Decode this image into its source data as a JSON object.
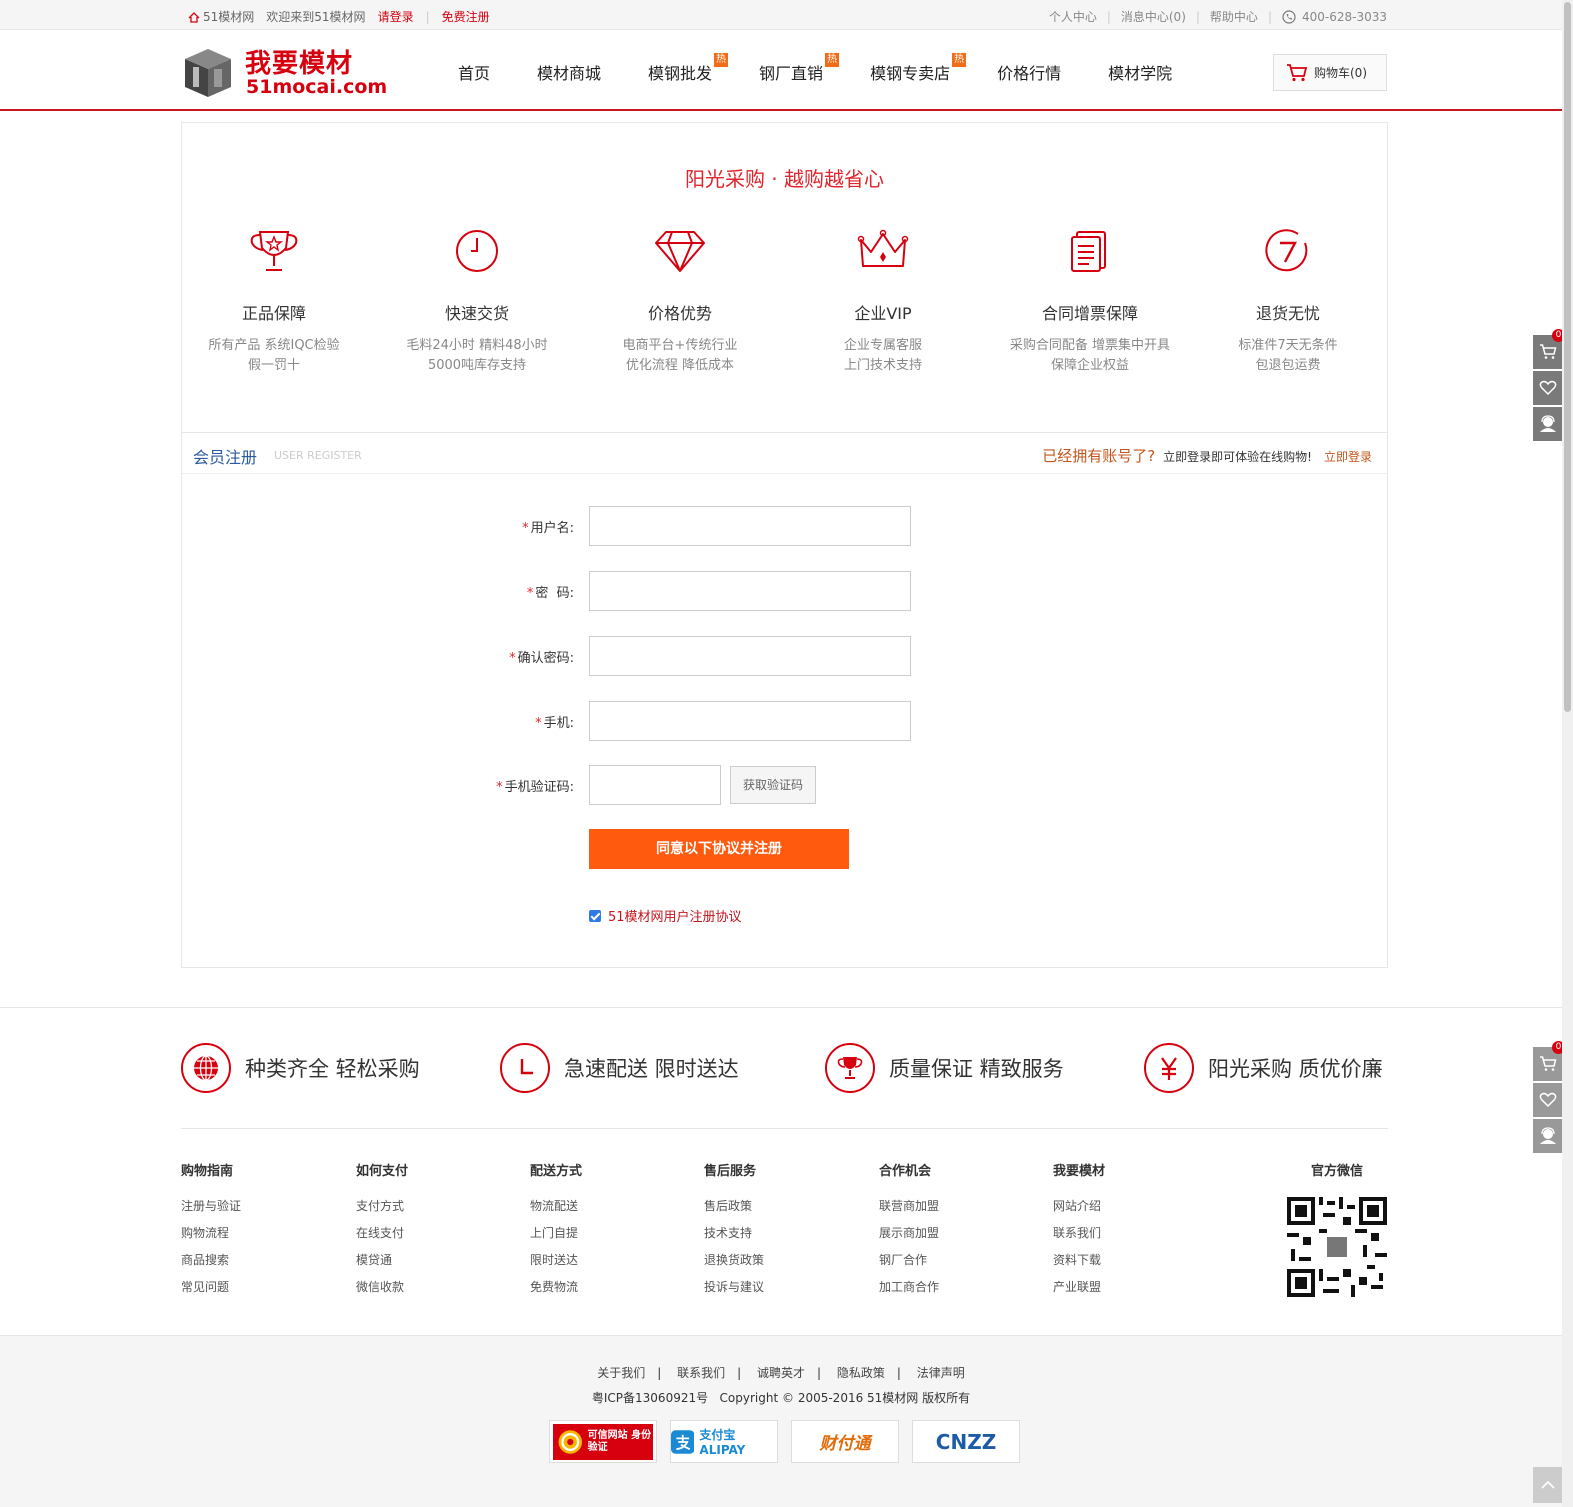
{
  "topbar": {
    "site": "51模材网",
    "welcome": "欢迎来到51模材网",
    "login": "请登录",
    "register": "免费注册",
    "links": [
      "个人中心",
      "消息中心(0)",
      "帮助中心"
    ],
    "phone": "400-628-3033"
  },
  "header": {
    "logo_cn": "我要模材",
    "logo_en": "51mocai.com",
    "nav": [
      "首页",
      "模材商城",
      "模钢批发",
      "钢厂直销",
      "模钢专卖店",
      "价格行情",
      "模材学院"
    ],
    "hot_label": "热",
    "cart": "购物车(0)"
  },
  "slogan": "阳光采购 · 越购越省心",
  "features": [
    {
      "title": "正品保障",
      "desc1": "所有产品 系统IQC检验",
      "desc2": "假一罚十",
      "icon": "trophy-icon"
    },
    {
      "title": "快速交货",
      "desc1": "毛料24小时 精料48小时",
      "desc2": "5000吨库存支持",
      "icon": "clock-icon"
    },
    {
      "title": "价格优势",
      "desc1": "电商平台+传统行业",
      "desc2": "优化流程 降低成本",
      "icon": "diamond-icon"
    },
    {
      "title": "企业VIP",
      "desc1": "企业专属客服",
      "desc2": "上门技术支持",
      "icon": "crown-icon"
    },
    {
      "title": "合同增票保障",
      "desc1": "采购合同配备 增票集中开具",
      "desc2": "保障企业权益",
      "icon": "document-icon"
    },
    {
      "title": "退货无忧",
      "desc1": "标准件7天无条件",
      "desc2": "包退包运费",
      "icon": "seven-day-icon"
    }
  ],
  "register": {
    "title": "会员注册",
    "subtitle": "USER REGISTER",
    "have_account": "已经拥有账号了?",
    "have_desc": "立即登录即可体验在线购物!",
    "login_link": "立即登录",
    "required_mark": "*",
    "fields": {
      "username": "用户名:",
      "password": "密  码:",
      "confirm": "确认密码:",
      "phone": "手机:",
      "code": "手机验证码:"
    },
    "get_code": "获取验证码",
    "submit": "同意以下协议并注册",
    "agreement": "51模材网用户注册协议"
  },
  "services": [
    "种类齐全 轻松采购",
    "急速配送 限时送达",
    "质量保证 精致服务",
    "阳光采购 质优价廉"
  ],
  "footer_cols": [
    {
      "title": "购物指南",
      "links": [
        "注册与验证",
        "购物流程",
        "商品搜索",
        "常见问题"
      ]
    },
    {
      "title": "如何支付",
      "links": [
        "支付方式",
        "在线支付",
        "模贷通",
        "微信收款"
      ]
    },
    {
      "title": "配送方式",
      "links": [
        "物流配送",
        "上门自提",
        "限时送达",
        "免费物流"
      ]
    },
    {
      "title": "售后服务",
      "links": [
        "售后政策",
        "技术支持",
        "退换货政策",
        "投诉与建议"
      ]
    },
    {
      "title": "合作机会",
      "links": [
        "联营商加盟",
        "展示商加盟",
        "钢厂合作",
        "加工商合作"
      ]
    },
    {
      "title": "我要模材",
      "links": [
        "网站介绍",
        "联系我们",
        "资料下载",
        "产业联盟"
      ]
    }
  ],
  "wechat_title": "官方微信",
  "bottom_links": [
    "关于我们",
    "联系我们",
    "诚聘英才",
    "隐私政策",
    "法律声明"
  ],
  "bottom_sep": "|",
  "copyright": "粤ICP备13060921号   Copyright © 2005-2016 51模材网 版权所有",
  "badges": [
    "可信网站 身份验证",
    "支付宝 ALIPAY",
    "财付通",
    "CNZZ"
  ],
  "side_count": "0",
  "colors": {
    "brand": "#d7000f",
    "accent": "#ff5a0e",
    "link_blue": "#2b5aa0"
  }
}
